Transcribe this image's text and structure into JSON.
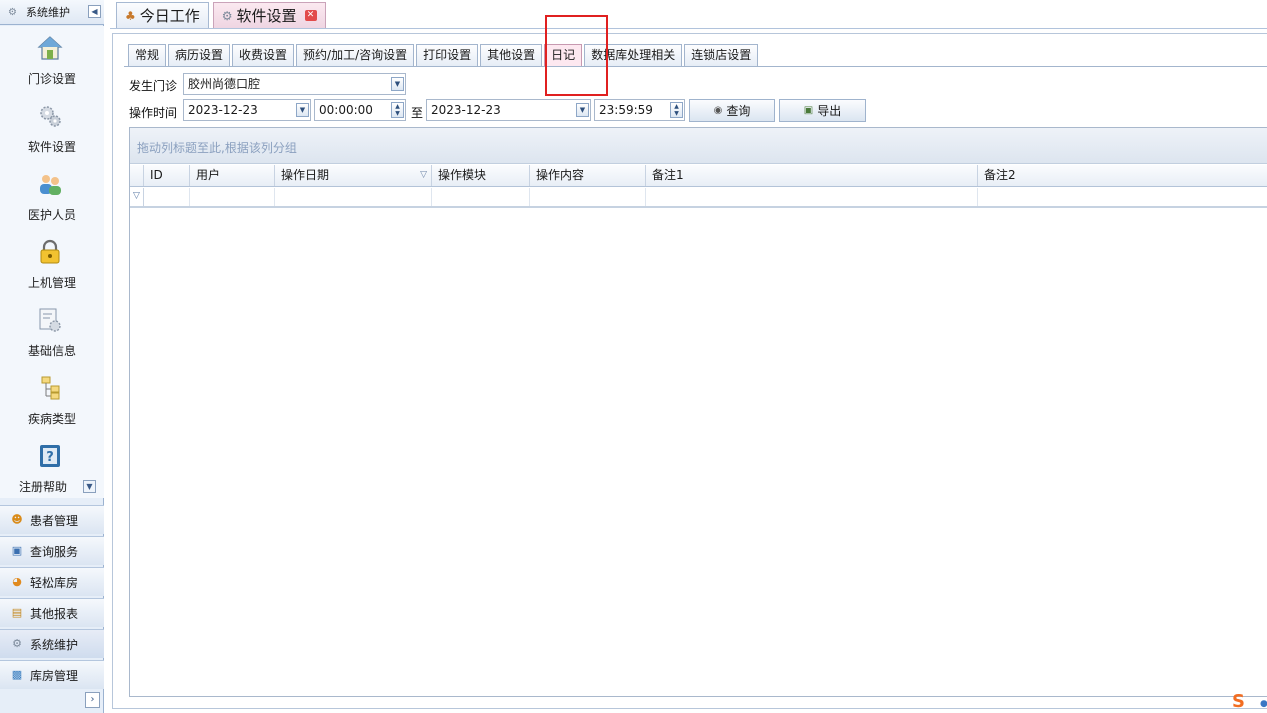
{
  "sidebar": {
    "header_label": "系统维护",
    "items": [
      {
        "label": "门诊设置",
        "icon": "home-icon"
      },
      {
        "label": "软件设置",
        "icon": "gears-icon"
      },
      {
        "label": "医护人员",
        "icon": "users-icon"
      },
      {
        "label": "上机管理",
        "icon": "lock-icon"
      },
      {
        "label": "基础信息",
        "icon": "info-gear-icon"
      },
      {
        "label": "疾病类型",
        "icon": "tree-icon"
      },
      {
        "label": "注册帮助",
        "icon": "help-icon"
      }
    ],
    "nav_buttons": [
      {
        "label": "患者管理",
        "icon": "patients-icon"
      },
      {
        "label": "查询服务",
        "icon": "search-icon"
      },
      {
        "label": "轻松库房",
        "icon": "warehouse-icon"
      },
      {
        "label": "其他报表",
        "icon": "report-icon"
      },
      {
        "label": "系统维护",
        "icon": "maintenance-icon"
      },
      {
        "label": "库房管理",
        "icon": "storage-icon"
      }
    ]
  },
  "doc_tabs": [
    {
      "label": "今日工作",
      "active": false
    },
    {
      "label": "软件设置",
      "active": true
    }
  ],
  "settings_tabs": [
    "常规",
    "病历设置",
    "收费设置",
    "预约/加工/咨询设置",
    "打印设置",
    "其他设置",
    "日记",
    "数据库处理相关",
    "连锁店设置"
  ],
  "settings_active_tab": "日记",
  "form": {
    "clinic_label": "发生门诊",
    "clinic_value": "胶州尚德口腔",
    "time_label": "操作时间",
    "start_date": "2023-12-23",
    "start_time": "00:00:00",
    "to_label": "至",
    "end_date": "2023-12-23",
    "end_time": "23:59:59",
    "query_button": "查询",
    "export_button": "导出"
  },
  "grid": {
    "group_hint": "拖动列标题至此,根据该列分组",
    "columns": [
      "ID",
      "用户",
      "操作日期",
      "操作模块",
      "操作内容",
      "备注1",
      "备注2"
    ]
  },
  "colors": {
    "highlight": "#e02020",
    "active_tab": "#fde8f0"
  }
}
